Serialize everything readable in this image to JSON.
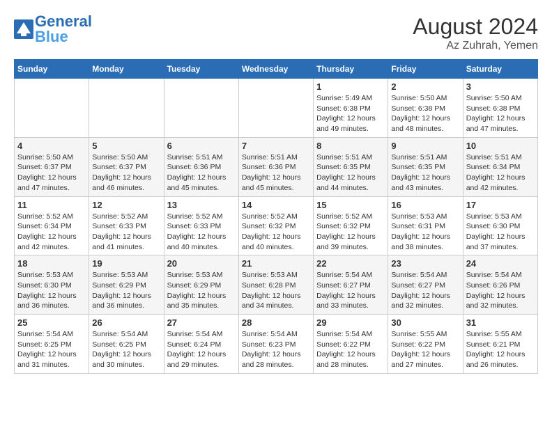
{
  "header": {
    "logo_general": "General",
    "logo_blue": "Blue",
    "month_year": "August 2024",
    "location": "Az Zuhrah, Yemen"
  },
  "days_of_week": [
    "Sunday",
    "Monday",
    "Tuesday",
    "Wednesday",
    "Thursday",
    "Friday",
    "Saturday"
  ],
  "weeks": [
    [
      {
        "day": "",
        "info": ""
      },
      {
        "day": "",
        "info": ""
      },
      {
        "day": "",
        "info": ""
      },
      {
        "day": "",
        "info": ""
      },
      {
        "day": "1",
        "info": "Sunrise: 5:49 AM\nSunset: 6:38 PM\nDaylight: 12 hours\nand 49 minutes."
      },
      {
        "day": "2",
        "info": "Sunrise: 5:50 AM\nSunset: 6:38 PM\nDaylight: 12 hours\nand 48 minutes."
      },
      {
        "day": "3",
        "info": "Sunrise: 5:50 AM\nSunset: 6:38 PM\nDaylight: 12 hours\nand 47 minutes."
      }
    ],
    [
      {
        "day": "4",
        "info": "Sunrise: 5:50 AM\nSunset: 6:37 PM\nDaylight: 12 hours\nand 47 minutes."
      },
      {
        "day": "5",
        "info": "Sunrise: 5:50 AM\nSunset: 6:37 PM\nDaylight: 12 hours\nand 46 minutes."
      },
      {
        "day": "6",
        "info": "Sunrise: 5:51 AM\nSunset: 6:36 PM\nDaylight: 12 hours\nand 45 minutes."
      },
      {
        "day": "7",
        "info": "Sunrise: 5:51 AM\nSunset: 6:36 PM\nDaylight: 12 hours\nand 45 minutes."
      },
      {
        "day": "8",
        "info": "Sunrise: 5:51 AM\nSunset: 6:35 PM\nDaylight: 12 hours\nand 44 minutes."
      },
      {
        "day": "9",
        "info": "Sunrise: 5:51 AM\nSunset: 6:35 PM\nDaylight: 12 hours\nand 43 minutes."
      },
      {
        "day": "10",
        "info": "Sunrise: 5:51 AM\nSunset: 6:34 PM\nDaylight: 12 hours\nand 42 minutes."
      }
    ],
    [
      {
        "day": "11",
        "info": "Sunrise: 5:52 AM\nSunset: 6:34 PM\nDaylight: 12 hours\nand 42 minutes."
      },
      {
        "day": "12",
        "info": "Sunrise: 5:52 AM\nSunset: 6:33 PM\nDaylight: 12 hours\nand 41 minutes."
      },
      {
        "day": "13",
        "info": "Sunrise: 5:52 AM\nSunset: 6:33 PM\nDaylight: 12 hours\nand 40 minutes."
      },
      {
        "day": "14",
        "info": "Sunrise: 5:52 AM\nSunset: 6:32 PM\nDaylight: 12 hours\nand 40 minutes."
      },
      {
        "day": "15",
        "info": "Sunrise: 5:52 AM\nSunset: 6:32 PM\nDaylight: 12 hours\nand 39 minutes."
      },
      {
        "day": "16",
        "info": "Sunrise: 5:53 AM\nSunset: 6:31 PM\nDaylight: 12 hours\nand 38 minutes."
      },
      {
        "day": "17",
        "info": "Sunrise: 5:53 AM\nSunset: 6:30 PM\nDaylight: 12 hours\nand 37 minutes."
      }
    ],
    [
      {
        "day": "18",
        "info": "Sunrise: 5:53 AM\nSunset: 6:30 PM\nDaylight: 12 hours\nand 36 minutes."
      },
      {
        "day": "19",
        "info": "Sunrise: 5:53 AM\nSunset: 6:29 PM\nDaylight: 12 hours\nand 36 minutes."
      },
      {
        "day": "20",
        "info": "Sunrise: 5:53 AM\nSunset: 6:29 PM\nDaylight: 12 hours\nand 35 minutes."
      },
      {
        "day": "21",
        "info": "Sunrise: 5:53 AM\nSunset: 6:28 PM\nDaylight: 12 hours\nand 34 minutes."
      },
      {
        "day": "22",
        "info": "Sunrise: 5:54 AM\nSunset: 6:27 PM\nDaylight: 12 hours\nand 33 minutes."
      },
      {
        "day": "23",
        "info": "Sunrise: 5:54 AM\nSunset: 6:27 PM\nDaylight: 12 hours\nand 32 minutes."
      },
      {
        "day": "24",
        "info": "Sunrise: 5:54 AM\nSunset: 6:26 PM\nDaylight: 12 hours\nand 32 minutes."
      }
    ],
    [
      {
        "day": "25",
        "info": "Sunrise: 5:54 AM\nSunset: 6:25 PM\nDaylight: 12 hours\nand 31 minutes."
      },
      {
        "day": "26",
        "info": "Sunrise: 5:54 AM\nSunset: 6:25 PM\nDaylight: 12 hours\nand 30 minutes."
      },
      {
        "day": "27",
        "info": "Sunrise: 5:54 AM\nSunset: 6:24 PM\nDaylight: 12 hours\nand 29 minutes."
      },
      {
        "day": "28",
        "info": "Sunrise: 5:54 AM\nSunset: 6:23 PM\nDaylight: 12 hours\nand 28 minutes."
      },
      {
        "day": "29",
        "info": "Sunrise: 5:54 AM\nSunset: 6:22 PM\nDaylight: 12 hours\nand 28 minutes."
      },
      {
        "day": "30",
        "info": "Sunrise: 5:55 AM\nSunset: 6:22 PM\nDaylight: 12 hours\nand 27 minutes."
      },
      {
        "day": "31",
        "info": "Sunrise: 5:55 AM\nSunset: 6:21 PM\nDaylight: 12 hours\nand 26 minutes."
      }
    ]
  ]
}
